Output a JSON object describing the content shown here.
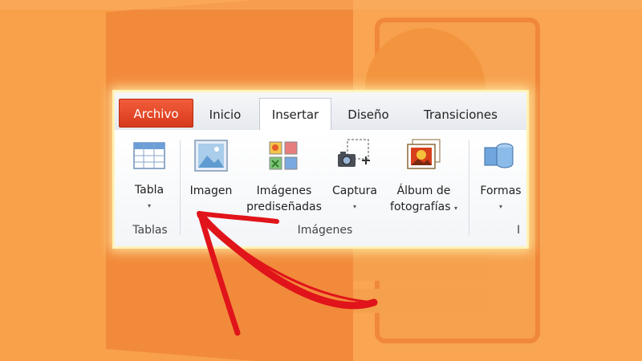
{
  "tabs": {
    "file": "Archivo",
    "home": "Inicio",
    "insert": "Insertar",
    "design": "Diseño",
    "transitions": "Transiciones"
  },
  "buttons": {
    "table": "Tabla",
    "image": "Imagen",
    "clipart_line1": "Imágenes",
    "clipart_line2": "prediseñadas",
    "capture": "Captura",
    "album_line1": "Álbum de",
    "album_line2": "fotografías",
    "shapes": "Formas"
  },
  "groups": {
    "tables": "Tablas",
    "images": "Imágenes",
    "cut_label": "I"
  },
  "dropdown_glyph": "▾",
  "icons": [
    "table-icon",
    "image-icon",
    "clipart-icon",
    "screenshot-icon",
    "photo-album-icon",
    "shapes-icon",
    "arrow-pointer"
  ],
  "colors": {
    "background": "#f79a3e",
    "file_tab": "#e2462a",
    "arrow": "#e0141a"
  }
}
